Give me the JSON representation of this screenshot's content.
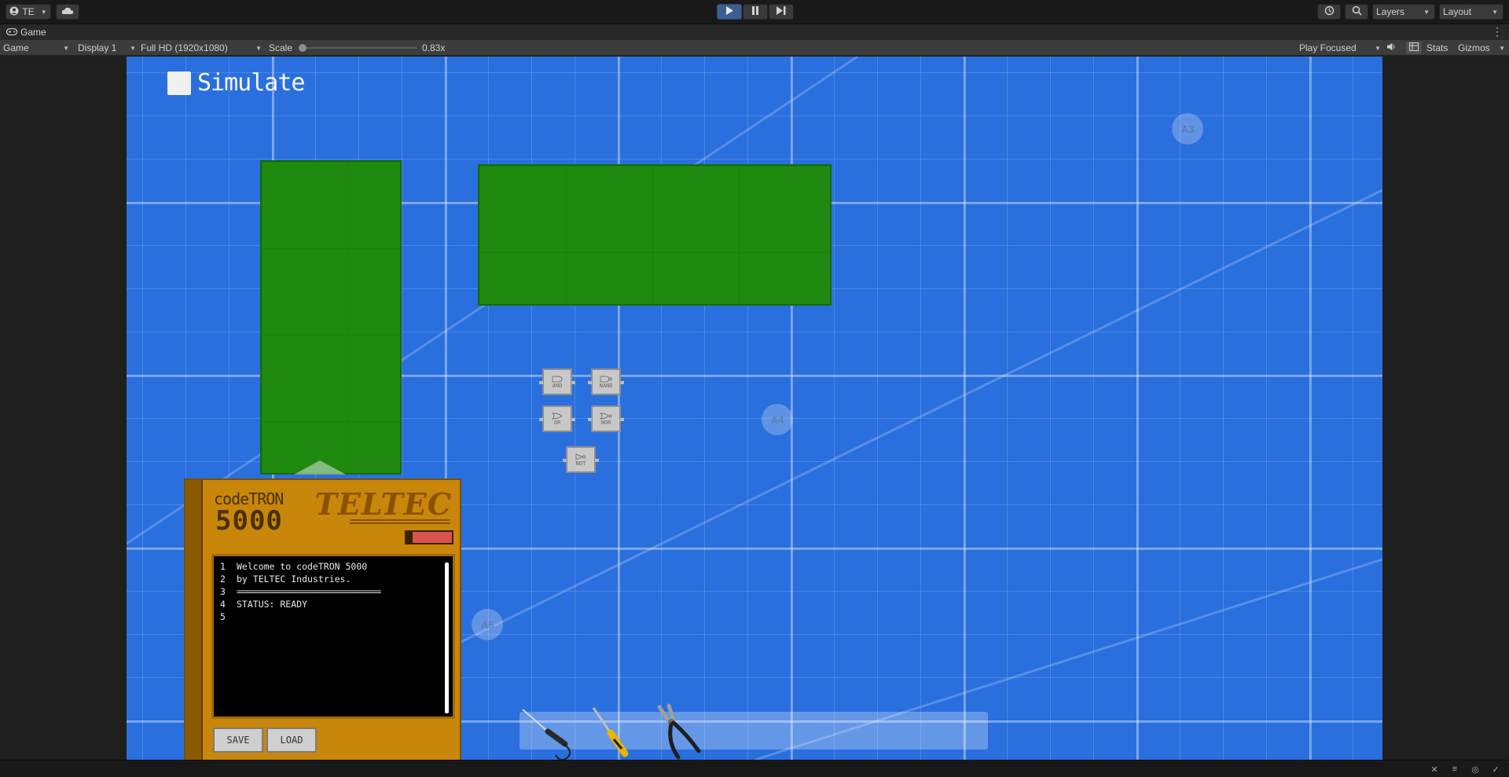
{
  "toolbar": {
    "account_label": "TE",
    "account_icon": "account-icon",
    "cloud_icon": "cloud-icon",
    "play_icon": "play-icon",
    "pause_icon": "pause-icon",
    "step_icon": "step-icon",
    "history_icon": "history-icon",
    "search_icon": "search-icon",
    "layers_label": "Layers",
    "layout_label": "Layout"
  },
  "tab": {
    "label": "Game",
    "icon": "gamepad-icon"
  },
  "gamebar": {
    "view_mode": "Game",
    "display": "Display 1",
    "resolution": "Full HD (1920x1080)",
    "scale_label": "Scale",
    "scale_value": "0.83x",
    "play_mode": "Play Focused",
    "stats_label": "Stats",
    "gizmos_label": "Gizmos"
  },
  "game": {
    "simulate_label": "Simulate",
    "simulate_checked": false,
    "markers": [
      "A3",
      "A4",
      "A5"
    ],
    "gates": [
      "AND",
      "NAND",
      "OR",
      "NOR",
      "NOT"
    ],
    "device": {
      "name": "codeTRON",
      "model": "5000",
      "brand": "TELTEC",
      "console_lines": [
        {
          "num": "1",
          "text": "Welcome to codeTRON 5000"
        },
        {
          "num": "2",
          "text": "by TELTEC Industries."
        },
        {
          "num": "3",
          "text": "================================"
        },
        {
          "num": "4",
          "text": "STATUS:  READY"
        },
        {
          "num": "5",
          "text": ""
        }
      ],
      "save_label": "SAVE",
      "load_label": "LOAD"
    },
    "tools": [
      "soldering-iron-icon",
      "screwdriver-icon",
      "pliers-icon"
    ]
  },
  "colors": {
    "canvas_blue": "#2a6fde",
    "board_green": "#1f8a0f",
    "device_orange": "#c8860a",
    "play_active": "#3b5f8f"
  }
}
